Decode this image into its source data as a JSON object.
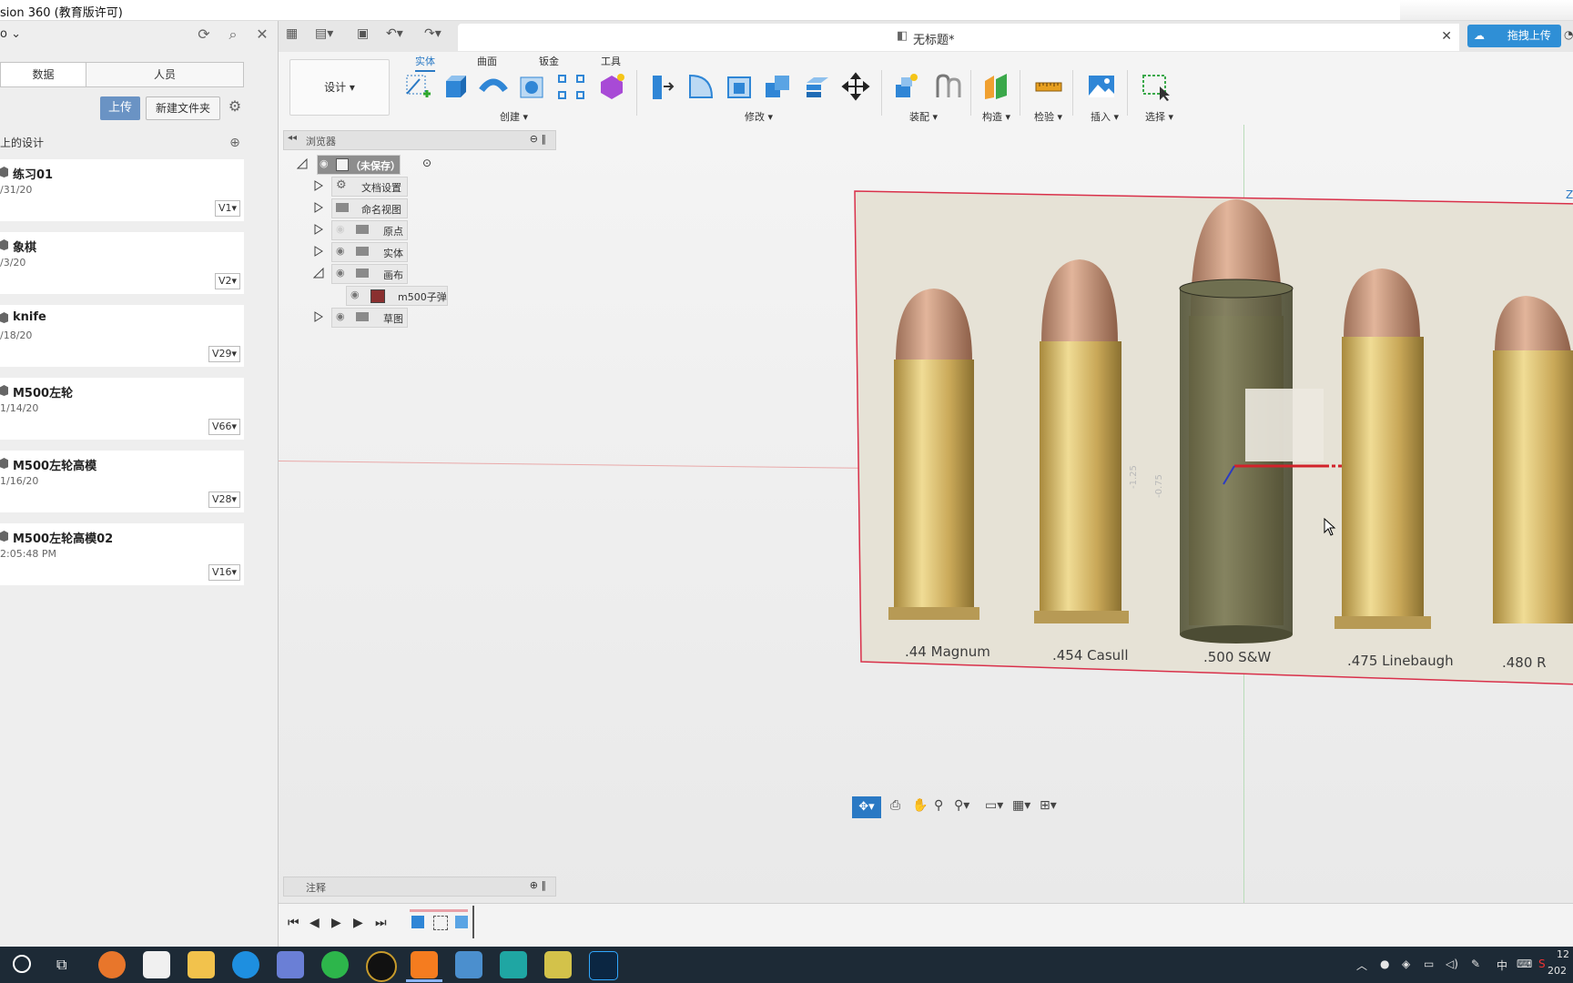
{
  "window": {
    "title": "sion 360 (教育版许可)"
  },
  "left_panel": {
    "project_label": "o",
    "tabs": [
      {
        "label": "数据"
      },
      {
        "label": "人员"
      }
    ],
    "upload_label": "上传",
    "new_folder_label": "新建文件夹",
    "section_title": "上的设计",
    "designs": [
      {
        "name": "练习01",
        "date": "/31/20",
        "version": "V1▾"
      },
      {
        "name": "象棋",
        "date": "/3/20",
        "version": "V2▾"
      },
      {
        "name": "knife",
        "date": "/18/20",
        "version": "V29▾"
      },
      {
        "name": "M500左轮",
        "date": "1/14/20",
        "version": "V66▾"
      },
      {
        "name": "M500左轮高模",
        "date": "1/16/20",
        "version": "V28▾"
      },
      {
        "name": "M500左轮高模02",
        "date": "2:05:48 PM",
        "version": "V16▾"
      }
    ]
  },
  "document": {
    "title": "无标题*",
    "cloud_upload_label": "拖拽上传"
  },
  "toolbar": {
    "workspace_label": "设计 ▾",
    "tabs": [
      "实体",
      "曲面",
      "钣金",
      "工具"
    ],
    "groups": [
      "创建 ▾",
      "修改 ▾",
      "装配 ▾",
      "构造 ▾",
      "检验 ▾",
      "插入 ▾",
      "选择 ▾"
    ]
  },
  "browser": {
    "title": "浏览器",
    "root": "（未保存）",
    "items": [
      "文档设置",
      "命名视图",
      "原点",
      "实体",
      "画布",
      "m500子弹",
      "草图"
    ]
  },
  "comments": {
    "label": "注释"
  },
  "canvas_image": {
    "labels": [
      ".44 Magnum",
      ".454 Casull",
      ".500 S&W",
      ".475 Linebaugh",
      ".480 R"
    ],
    "dim_labels": [
      "-1.25",
      "-0.75"
    ],
    "axis_label": "Z"
  },
  "taskbar": {
    "tray_lang": "中",
    "tray_time": "12",
    "tray_date": "202"
  },
  "colors": {
    "accent": "#2a79c4",
    "upload_button": "#6a93c4",
    "taskbar": "#1d2a36",
    "canvas_border": "#d9304a"
  }
}
